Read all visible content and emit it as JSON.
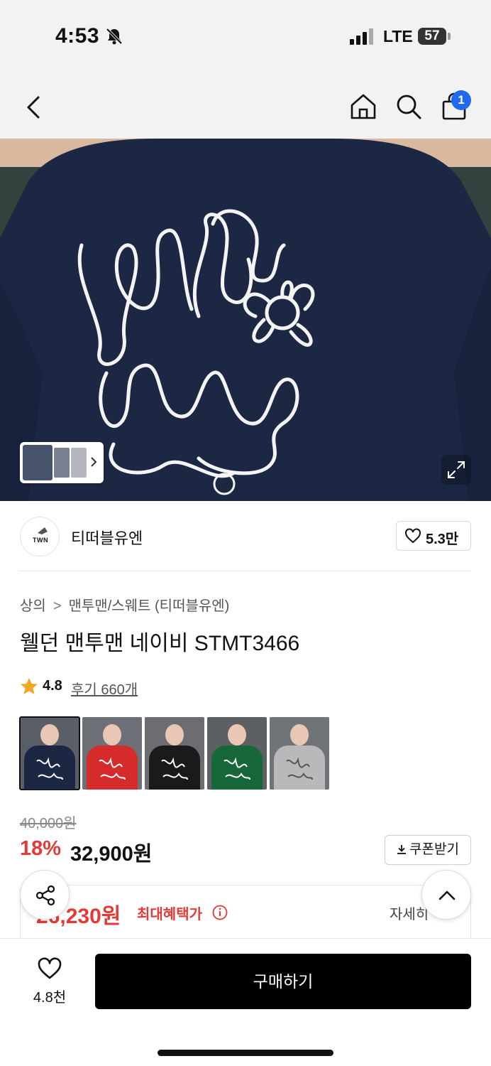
{
  "status_bar": {
    "time": "4:53",
    "network": "LTE",
    "battery": "57",
    "icons": [
      "bell-muted-icon",
      "signal-icon",
      "battery-icon"
    ]
  },
  "nav": {
    "cart_badge": "1",
    "icons": [
      "back-icon",
      "home-icon",
      "search-icon",
      "bag-icon"
    ]
  },
  "hero": {
    "icons": [
      "chevron-right-icon",
      "expand-icon"
    ]
  },
  "brand": {
    "logo_text": "TWN",
    "name": "티떠블유엔",
    "like_count": "5.3만"
  },
  "breadcrumb": {
    "category": "상의",
    "subcategory": "맨투맨/스웨트 (티떠블유엔)"
  },
  "product": {
    "title": "웰던 맨투맨 네이비 STMT3466",
    "rating": "4.8",
    "reviews": "후기 660개",
    "swatches": [
      {
        "color": "#1c2744",
        "selected": true
      },
      {
        "color": "#d62b2b",
        "selected": false
      },
      {
        "color": "#1a1a1a",
        "selected": false
      },
      {
        "color": "#17673a",
        "selected": false
      },
      {
        "color": "#b9b9bb",
        "selected": false
      }
    ]
  },
  "pricing": {
    "original": "40,000원",
    "discount": "18%",
    "price": "32,900원",
    "coupon_label": "쿠폰받기",
    "benefit_price": "26,230원",
    "benefit_label": "최대혜택가",
    "benefit_detail": "자세히"
  },
  "bottom": {
    "wish_count": "4.8천",
    "buy_label": "구매하기"
  },
  "colors": {
    "accent_red": "#e53935",
    "badge_blue": "#1f6af0",
    "sweatshirt_navy": "#1c2744"
  }
}
